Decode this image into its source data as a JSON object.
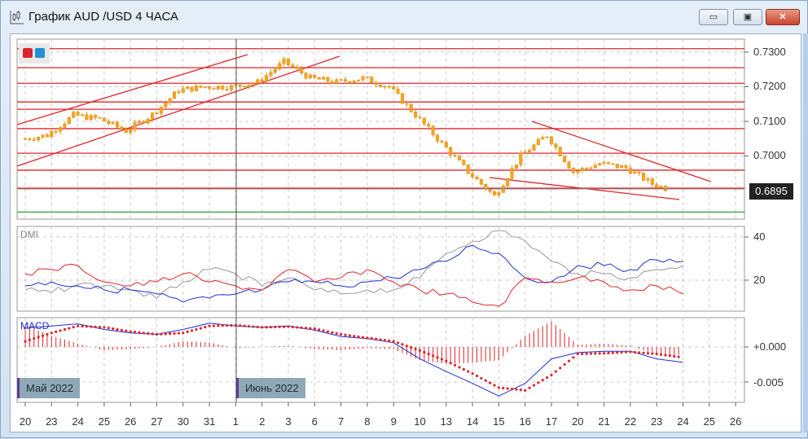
{
  "window": {
    "title": "График AUD /USD  4 ЧАСА",
    "buttons": {
      "minimize": "▭",
      "maximize": "▣",
      "close": "✕"
    }
  },
  "price_axis": {
    "ticks": [
      "0.7300",
      "0.7200",
      "0.7100",
      "0.7000"
    ],
    "tick_values": [
      0.73,
      0.72,
      0.71,
      0.7
    ],
    "current_price": "0.6895"
  },
  "indicators": {
    "dmi": {
      "label": "DMI",
      "ticks": [
        "40",
        "20"
      ]
    },
    "macd": {
      "label": "MACD",
      "ticks": [
        "+0.000",
        "-0.005"
      ]
    }
  },
  "months": [
    "Май 2022",
    "Июнь 2022"
  ],
  "x_labels": [
    "20",
    "23",
    "24",
    "25",
    "26",
    "27",
    "30",
    "31",
    "1",
    "2",
    "3",
    "6",
    "7",
    "8",
    "9",
    "10",
    "13",
    "14",
    "15",
    "16",
    "17",
    "20",
    "21",
    "22",
    "23",
    "24",
    "25",
    "26"
  ],
  "colors": {
    "candle": "#f5a623",
    "level": "#e0242b",
    "support": "#2ea043",
    "di_plus": "#1f2fd0",
    "di_minus": "#e0242b",
    "adx": "#999999",
    "macd": "#1f2fd0",
    "signal": "#e0242b"
  },
  "chart_data": {
    "type": "candlestick",
    "title": "AUD/USD 4H",
    "close_by_day": [
      0.7048,
      0.706,
      0.7118,
      0.7107,
      0.7072,
      0.712,
      0.719,
      0.72,
      0.72,
      0.7213,
      0.7272,
      0.7225,
      0.7213,
      0.7225,
      0.72,
      0.7118,
      0.7036,
      0.6954,
      0.6884,
      0.7,
      0.706,
      0.6954,
      0.6978,
      0.6966,
      0.6919,
      0.6895
    ],
    "levels": [
      0.731,
      0.7255,
      0.721,
      0.7156,
      0.7135,
      0.7079,
      0.7008,
      0.6959,
      0.6907
    ],
    "support_level": 0.6838,
    "dmi": {
      "di_plus": [
        17.4,
        19.2,
        17.4,
        15.5,
        15.5,
        13.6,
        9.8,
        11.7,
        13.6,
        15.5,
        19.2,
        19.2,
        17.4,
        19.2,
        21.1,
        24.9,
        28.7,
        36.2,
        32.5,
        21.1,
        19.2,
        26.8,
        26.8,
        24.9,
        29.4,
        28.7
      ],
      "di_minus": [
        23,
        24.9,
        26.8,
        19.2,
        17.4,
        19.2,
        23,
        19.2,
        17.4,
        15.5,
        24.9,
        19.2,
        21.1,
        24.9,
        19.2,
        15.5,
        13.6,
        9.8,
        7.9,
        21.1,
        19.2,
        21.1,
        19.2,
        15.5,
        17.4,
        13.6
      ],
      "adx": [
        15.5,
        14.3,
        18.1,
        17.4,
        15.5,
        11.7,
        19.2,
        24.9,
        23,
        17.4,
        21.1,
        15.5,
        13.6,
        15.5,
        15.5,
        21.1,
        32.5,
        38.1,
        43,
        38.1,
        28.7,
        23,
        23,
        21.1,
        24.9,
        26.8
      ],
      "ylim": [
        5,
        45
      ]
    },
    "macd": {
      "macd": [
        0.0027,
        0.003,
        0.0033,
        0.0025,
        0.002,
        0.0018,
        0.0025,
        0.0034,
        0.003,
        0.0028,
        0.003,
        0.0024,
        0.0015,
        0.0012,
        0.0006,
        -0.0017,
        -0.0035,
        -0.0052,
        -0.007,
        -0.0052,
        -0.0017,
        -0.0008,
        -0.0006,
        -0.0006,
        -0.0017,
        -0.0022
      ],
      "signal": [
        0.0008,
        0.002,
        0.003,
        0.0028,
        0.0022,
        0.0018,
        0.002,
        0.003,
        0.0031,
        0.0028,
        0.0029,
        0.0026,
        0.0018,
        0.0013,
        0.0008,
        -0.0005,
        -0.002,
        -0.0038,
        -0.0058,
        -0.0062,
        -0.004,
        -0.001,
        -0.0009,
        -0.0007,
        -0.001,
        -0.0015
      ],
      "ylim": [
        -0.0078,
        0.0042
      ]
    }
  }
}
